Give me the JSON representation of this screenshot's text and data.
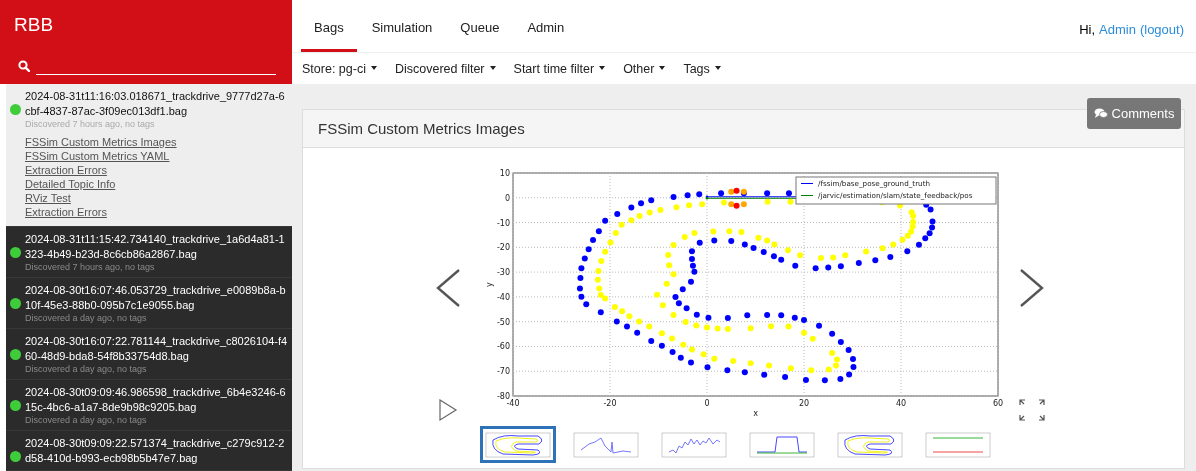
{
  "sidebar": {
    "title": "RBB",
    "bags": [
      {
        "name": "2024-08-31t11:16:03.018671_trackdrive_9777d27a-6cbf-4837-87ac-3f09ec013df1.bag",
        "meta": "Discovered 7 hours ago, no tags",
        "selected": true,
        "links": [
          "FSSim Custom Metrics Images",
          "FSSim Custom Metrics YAML",
          "Extraction Errors",
          "Detailed Topic Info",
          "RViz Test",
          "Extraction Errors"
        ]
      },
      {
        "name": "2024-08-31t11:15:42.734140_trackdrive_1a6d4a81-1323-4b49-b23d-8c6cb86a2867.bag",
        "meta": "Discovered 7 hours ago, no tags",
        "selected": false
      },
      {
        "name": "2024-08-30t16:07:46.053729_trackdrive_e0089b8a-b10f-45e3-88b0-095b7c1e9055.bag",
        "meta": "Discovered a day ago, no tags",
        "selected": false
      },
      {
        "name": "2024-08-30t16:07:22.781144_trackdrive_c8026104-f460-48d9-bda8-54f8b33754d8.bag",
        "meta": "Discovered a day ago, no tags",
        "selected": false
      },
      {
        "name": "2024-08-30t09:09:46.986598_trackdrive_6b4e3246-615c-4bc6-a1a7-8de9b98c9205.bag",
        "meta": "Discovered a day ago, no tags",
        "selected": false
      },
      {
        "name": "2024-08-30t09:09:22.571374_trackdrive_c279c912-2d58-410d-b993-ecb98b5b47e7.bag",
        "selected": false
      }
    ]
  },
  "nav": {
    "tabs": [
      {
        "label": "Bags",
        "selected": true
      },
      {
        "label": "Simulation",
        "selected": false
      },
      {
        "label": "Queue",
        "selected": false
      },
      {
        "label": "Admin",
        "selected": false
      }
    ],
    "greeting": "Hi,",
    "user": "Admin",
    "logout": "(logout)",
    "filters": [
      "Store: pg-ci",
      "Discovered filter",
      "Start time filter",
      "Other",
      "Tags"
    ]
  },
  "panel": {
    "title": "FSSim Custom Metrics Images",
    "comments_button": "Comments",
    "chart_data": {
      "type": "scatter",
      "grid": true,
      "legend": "upper right",
      "xlabel": "x",
      "ylabel": "y",
      "xlim": [
        -40,
        60
      ],
      "ylim": [
        -80,
        10
      ],
      "xticks": [
        -40,
        -20,
        0,
        20,
        40,
        60
      ],
      "yticks": [
        10,
        0,
        -10,
        -20,
        -30,
        -40,
        -50,
        -60,
        -70,
        -80
      ],
      "series": [
        {
          "name": "/fssim/base_pose_ground_truth",
          "type": "line",
          "color": "#0000ff",
          "x": [
            0,
            19
          ],
          "values": [
            0.4,
            0.4
          ]
        },
        {
          "name": "/jarvic/estimation/slam/state_feedback/pos",
          "type": "line",
          "color": "#008000",
          "x": [
            0,
            19
          ],
          "values": [
            -0.2,
            -0.2
          ]
        },
        {
          "color": "#0000ff",
          "x": [
            -6.9,
            -4,
            -1.6,
            2.9,
            7.6,
            12.4,
            16.9,
            -11.5,
            -13.6,
            -15.6,
            -18.5,
            -21,
            -22.3,
            -23.5,
            -24.4,
            -25.2,
            -25.9,
            -26.1,
            -26.2,
            -25.9,
            -24.9,
            -21.9,
            -18.6,
            -16.5,
            -14.4,
            -11.5,
            -9.3,
            -7.1,
            -5.4,
            -3.3,
            0.1,
            4.2,
            7.8,
            11.8,
            16.1,
            20.4,
            24.3,
            27.5,
            -1.5,
            1.5,
            5,
            7.8,
            9.6,
            11.7,
            13.8,
            15.3,
            18.2,
            22.4,
            25,
            27.6,
            -3.1,
            -3.1,
            -2.9,
            -2.6,
            -3.3,
            -5,
            -6.5,
            -5.8,
            -4.2,
            -2.1,
            0.3,
            4.3,
            8.3,
            12.4,
            15.3,
            18.1,
            20,
            23.1,
            25.8,
            45.2,
            46.1,
            46.5,
            46.4,
            45.9,
            45,
            43.7,
            41.3,
            37.8,
            34.7,
            31.3,
            27.6,
            29.2,
            30.1,
            30.2,
            29.3
          ],
          "values": [
            0.3,
            1,
            1.4,
            1.8,
            1.8,
            1.8,
            1.8,
            -1,
            -2.2,
            -3.9,
            -6.5,
            -9.3,
            -13.5,
            -17,
            -20.8,
            -24.5,
            -28.4,
            -32.4,
            -36.6,
            -39.9,
            -43,
            -46.2,
            -49.9,
            -52,
            -54.5,
            -57.8,
            -59.7,
            -62.2,
            -64.6,
            -66.5,
            -68.4,
            -69.6,
            -70.4,
            -71.4,
            -72.3,
            -73.5,
            -73.6,
            -73.1,
            -18.1,
            -17.2,
            -17.4,
            -18.9,
            -20.3,
            -21.9,
            -23.6,
            -25,
            -27.4,
            -28.4,
            -28.1,
            -27.6,
            -21.6,
            -24.7,
            -27.4,
            -29.9,
            -33.9,
            -36.9,
            -40,
            -42.6,
            -44.6,
            -47.2,
            -48.4,
            -48.5,
            -47.4,
            -47.3,
            -47.4,
            -48.4,
            -49.3,
            -51.6,
            -54.9,
            -2.8,
            -4.7,
            -9.6,
            -12,
            -14.3,
            -16.3,
            -19,
            -21.6,
            -23.9,
            -25.2,
            -26.3,
            -58.2,
            -61.4,
            -65.1,
            -68.3,
            -71.3
          ]
        },
        {
          "color": "#ffff00",
          "x": [
            -1,
            -3.7,
            -6.3,
            -9.6,
            -11.8,
            -13.9,
            -15.6,
            -17.6,
            -18.8,
            -19.9,
            -21,
            -21.8,
            -22.4,
            -22.5,
            -22.2,
            -21.9,
            -21,
            -19,
            -17.5,
            -16,
            -14,
            -11.9,
            -9.3,
            -7.2,
            -4.9,
            -3.1,
            -0.7,
            1.5,
            5.4,
            9,
            12.8,
            17.3,
            21.5,
            25.1,
            26.6,
            26.8,
            25.8,
            1.3,
            4.6,
            7.1,
            10.6,
            12.4,
            13.9,
            16.7,
            19.2,
            23.5,
            26,
            -2.6,
            -4.6,
            -6.9,
            -8,
            -7.8,
            -6.9,
            -8.3,
            -10.3,
            -9.1,
            -6.9,
            -4.4,
            -2.2,
            0,
            2.2,
            4.3,
            9,
            13.2,
            16.8,
            20,
            21.8,
            39.8,
            42.2,
            42.5,
            42.5,
            42.4,
            42.1,
            41.4,
            40.3,
            38.4,
            36.2,
            32.8,
            28.5,
            3.5,
            12.5,
            17.2,
            36
          ],
          "values": [
            -2.6,
            -3,
            -3.8,
            -4.9,
            -5.9,
            -7.4,
            -9.1,
            -10.9,
            -14.2,
            -18,
            -21.8,
            -25.5,
            -29.6,
            -33.1,
            -36.6,
            -39.2,
            -40.7,
            -44.1,
            -45.8,
            -47.8,
            -49.9,
            -52,
            -54.7,
            -56.8,
            -59.3,
            -61.2,
            -63.2,
            -65,
            -65.9,
            -66.8,
            -67.7,
            -68.8,
            -69.6,
            -69.3,
            -67.7,
            -65.3,
            -62.6,
            -13.6,
            -13.5,
            -13.8,
            -16.1,
            -17.2,
            -18.9,
            -21.2,
            -23.2,
            -24.3,
            -24.1,
            -14.2,
            -15.8,
            -19.1,
            -23.1,
            -27.2,
            -30.9,
            -34.7,
            -39.1,
            -43.4,
            -47.3,
            -50.1,
            -51.5,
            -52.4,
            -52.8,
            -53,
            -52.7,
            -51.8,
            -52,
            -54.5,
            -56.9,
            -3.1,
            -5.8,
            -7.4,
            -9.8,
            -11.6,
            -13.6,
            -15.3,
            -16.9,
            -18.9,
            -20.4,
            -21.7,
            -23.2,
            -1.9,
            -1.6,
            -1.6,
            -1.8
          ]
        },
        {
          "color": "#ffa500",
          "x": [
            5,
            7.6,
            5,
            7.6
          ],
          "values": [
            2.4,
            2.4,
            -2.6,
            -2.6
          ]
        },
        {
          "color": "#ff0000",
          "x": [
            6.1,
            6.1
          ],
          "values": [
            2.8,
            -3.2
          ]
        }
      ]
    },
    "thumbnails": [
      {
        "kind": "track",
        "selected": true
      },
      {
        "kind": "spike",
        "selected": false
      },
      {
        "kind": "noise",
        "selected": false
      },
      {
        "kind": "step",
        "selected": false
      },
      {
        "kind": "track",
        "selected": false
      },
      {
        "kind": "flat",
        "selected": false
      }
    ]
  }
}
